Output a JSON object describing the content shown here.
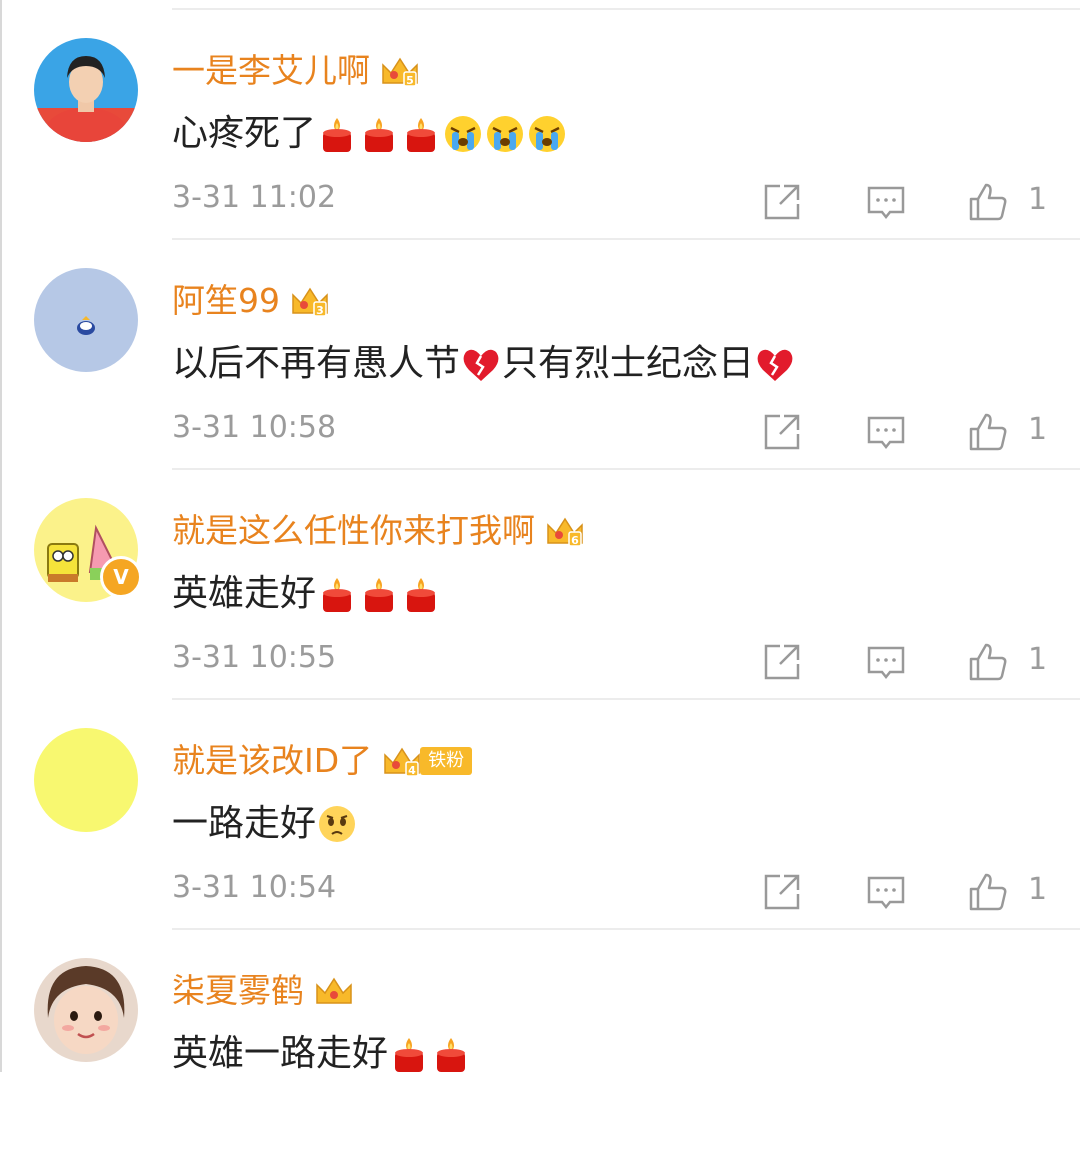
{
  "comments": [
    {
      "username": "一是李艾儿啊",
      "level": "5",
      "fan_badge": "",
      "verified": false,
      "text": "心疼死了",
      "emojis": [
        "candle-icon",
        "candle-icon",
        "candle-icon",
        "crying-face-icon",
        "crying-face-icon",
        "crying-face-icon"
      ],
      "time": "3-31 11:02",
      "likes": "1",
      "avatar": "person-red-shirt"
    },
    {
      "username": "阿笙99",
      "level": "3",
      "fan_badge": "",
      "verified": false,
      "text_parts": [
        "以后不再有愚人节",
        "只有烈士纪念日"
      ],
      "emojis": [
        "broken-heart-icon",
        "broken-heart-icon"
      ],
      "time": "3-31 10:58",
      "likes": "1",
      "avatar": "cartoon-blue"
    },
    {
      "username": "就是这么任性你来打我啊",
      "level": "6",
      "fan_badge": "",
      "verified": true,
      "text": "英雄走好",
      "emojis": [
        "candle-icon",
        "candle-icon",
        "candle-icon"
      ],
      "time": "3-31 10:55",
      "likes": "1",
      "avatar": "spongebob-patrick"
    },
    {
      "username": "就是该改ID了",
      "level": "4",
      "fan_badge": "铁粉",
      "verified": false,
      "text": "一路走好",
      "emojis": [
        "sad-face-icon"
      ],
      "time": "3-31 10:54",
      "likes": "1",
      "avatar": "plain-yellow"
    },
    {
      "username": "柒夏雾鹤",
      "level": "",
      "fan_badge": "",
      "verified": false,
      "text": "英雄一路走好",
      "emojis": [
        "candle-icon",
        "candle-icon"
      ],
      "time": "",
      "likes": "",
      "avatar": "child-photo"
    }
  ],
  "colors": {
    "username": "#e8831e",
    "text": "#222222",
    "meta": "#9b9b9b",
    "divider": "#ececec"
  }
}
